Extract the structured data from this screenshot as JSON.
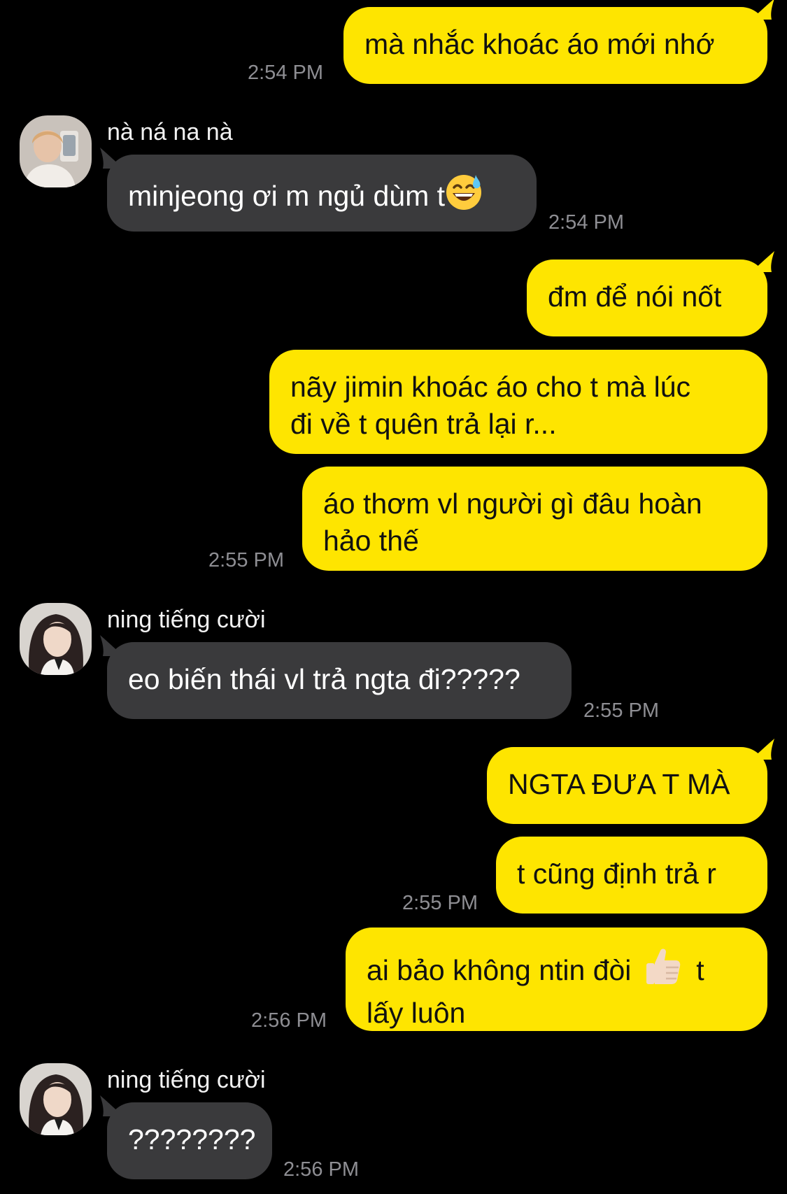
{
  "chat": {
    "messages": [
      {
        "id": 1,
        "side": "out",
        "lines": [
          "mà nhắc khoác áo mới nhớ"
        ],
        "time": "2:54 PM"
      },
      {
        "id": 2,
        "side": "in",
        "sender": "nà ná na nà",
        "avatar": "person-photo-avatar",
        "lines": [
          "minjeong ơi m ngủ dùm t"
        ],
        "emoji": "sweat-smile-emoji",
        "time": "2:54 PM"
      },
      {
        "id": 3,
        "side": "out",
        "lines": [
          "đm để nói nốt"
        ]
      },
      {
        "id": 4,
        "side": "out",
        "lines": [
          "nãy jimin khoác áo cho t mà lúc",
          "đi về t quên trả lại r..."
        ]
      },
      {
        "id": 5,
        "side": "out",
        "lines": [
          "áo thơm vl người gì đâu hoàn",
          "hảo thế"
        ],
        "time": "2:55 PM"
      },
      {
        "id": 6,
        "side": "in",
        "sender": "ning tiếng cười",
        "avatar": "person-photo-avatar",
        "lines": [
          "eo biến thái vl trả ngta đi?????"
        ],
        "time": "2:55 PM"
      },
      {
        "id": 7,
        "side": "out",
        "lines": [
          "NGTA ĐƯA T MÀ"
        ]
      },
      {
        "id": 8,
        "side": "out",
        "lines": [
          "t cũng định trả r"
        ],
        "time": "2:55 PM"
      },
      {
        "id": 9,
        "side": "out",
        "lines": [
          "ai bảo không ntin đòi",
          "lấy luôn"
        ],
        "emoji": "thumbs-up-emoji",
        "after_emoji": "t",
        "time": "2:56 PM"
      },
      {
        "id": 10,
        "side": "in",
        "sender": "ning tiếng cười",
        "avatar": "person-photo-avatar",
        "lines": [
          "????????"
        ],
        "time": "2:56 PM"
      }
    ]
  },
  "colors": {
    "background": "#000000",
    "outgoing_bubble": "#fee500",
    "incoming_bubble": "#3a3a3c",
    "timestamp": "#8e8e93"
  }
}
